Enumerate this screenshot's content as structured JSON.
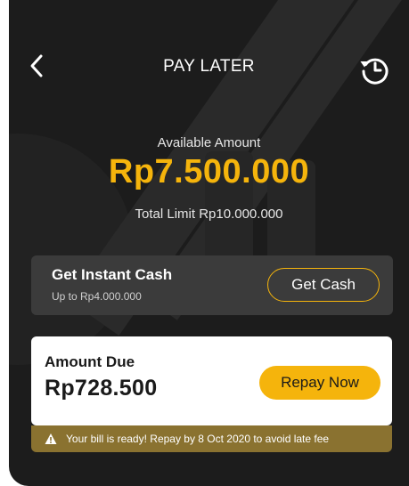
{
  "header": {
    "title": "PAY LATER",
    "back_icon": "chevron-left-icon",
    "history_icon": "history-clock-icon"
  },
  "balance": {
    "label": "Available Amount",
    "amount": "Rp7.500.000",
    "total_limit": "Total Limit Rp10.000.000"
  },
  "instant_cash": {
    "title": "Get Instant Cash",
    "subtitle": "Up to Rp4.000.000",
    "button_label": "Get Cash"
  },
  "amount_due": {
    "title": "Amount Due",
    "amount": "Rp728.500",
    "button_label": "Repay Now"
  },
  "notice": {
    "icon": "warning-icon",
    "text": "Your bill is ready! Repay by 8 Oct 2020 to avoid late fee"
  },
  "colors": {
    "background": "#1c1c1c",
    "accent": "#f5b40c",
    "card_dark": "#3b3b3b",
    "notice_bar": "#8a7230"
  }
}
